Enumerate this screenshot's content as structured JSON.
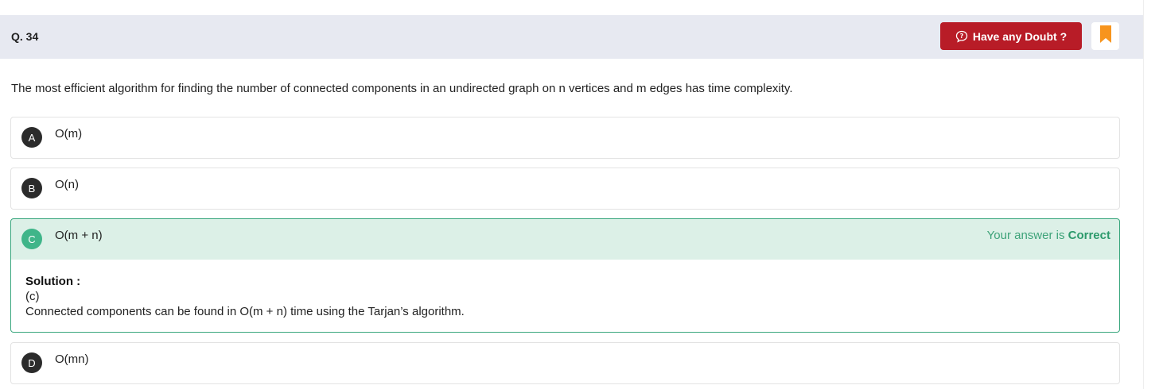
{
  "question": {
    "number_label": "Q. 34",
    "text": "The most efficient algorithm for finding the number of connected components in an undirected graph on n vertices and m edges has time complexity."
  },
  "header": {
    "doubt_button_label": "Have any Doubt ?",
    "doubt_icon": "question-bubble-icon",
    "bookmark_icon": "bookmark-icon",
    "accent_color": "#b81c27",
    "bookmark_color": "#f7941d"
  },
  "options": [
    {
      "letter": "A",
      "text": "O(m)"
    },
    {
      "letter": "B",
      "text": "O(n)"
    },
    {
      "letter": "C",
      "text": "O(m + n)"
    },
    {
      "letter": "D",
      "text": "O(mn)"
    }
  ],
  "result": {
    "prefix": "Your answer is ",
    "status": "Correct",
    "correct_option": "C",
    "color": "#3fb589"
  },
  "solution": {
    "title": "Solution :",
    "answer": "(c)",
    "explanation": "Connected components can be found in O(m + n) time using the Tarjan’s algorithm."
  }
}
